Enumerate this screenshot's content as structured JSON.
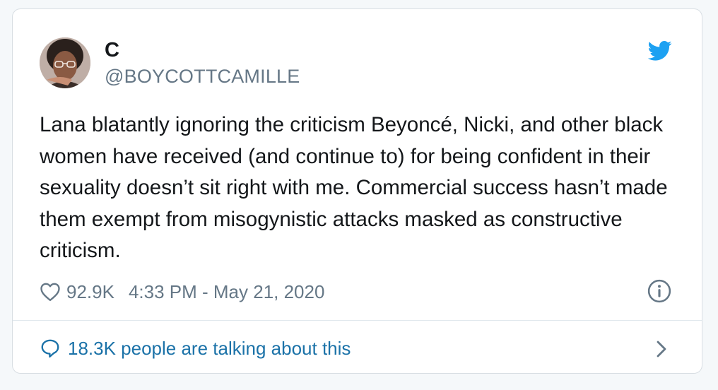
{
  "tweet": {
    "display_name": "C",
    "handle": "@BOYCOTTCAMILLE",
    "text": "Lana blatantly ignoring the criticism Beyoncé, Nicki, and other black women have received (and continue to) for being confident in their sexuality doesn’t sit right with me. Commercial success hasn’t made them exempt from misogynistic attacks masked as constructive criticism.",
    "likes": "92.9K",
    "timestamp": "4:33 PM - May 21, 2020",
    "conversation_label": "18.3K people are talking about this"
  },
  "icons": {
    "brand": "twitter-bird-icon",
    "like": "heart-icon",
    "info": "info-icon",
    "reply": "speech-bubble-icon",
    "more": "chevron-right-icon"
  },
  "colors": {
    "twitter_blue": "#1da1f2",
    "link_blue": "#1b72a8",
    "text": "#14171a",
    "secondary": "#657786"
  }
}
